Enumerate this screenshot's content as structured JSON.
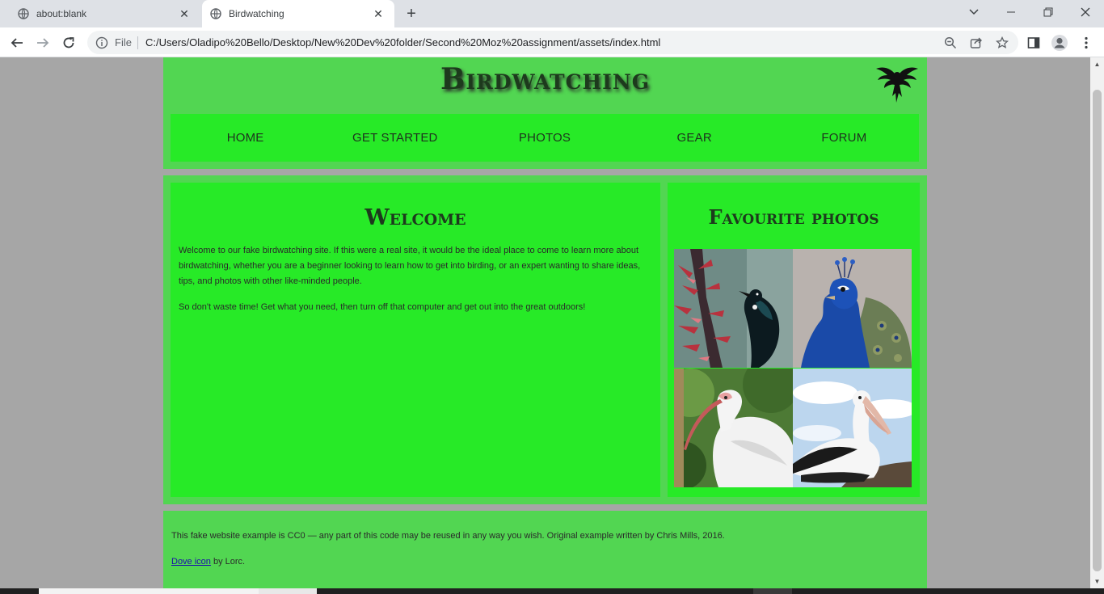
{
  "browser": {
    "tabs": [
      {
        "title": "about:blank",
        "active": false
      },
      {
        "title": "Birdwatching",
        "active": true
      }
    ],
    "new_tab_symbol": "+",
    "close_symbol": "✕",
    "address": {
      "scheme_label": "File",
      "url": "C:/Users/Oladipo%20Bello/Desktop/New%20Dev%20folder/Second%20Moz%20assignment/assets/index.html"
    }
  },
  "site": {
    "title": "Birdwatching",
    "logo_icon": "dove-icon",
    "nav": [
      "HOME",
      "GET STARTED",
      "PHOTOS",
      "GEAR",
      "FORUM"
    ],
    "welcome": {
      "heading": "Welcome",
      "paragraphs": [
        "Welcome to our fake birdwatching site. If this were a real site, it would be the ideal place to come to learn more about birdwatching, whether you are a beginner looking to learn how to get into birding, or an expert wanting to share ideas, tips, and photos with other like-minded people.",
        "So don't waste time! Get what you need, then turn off that computer and get out into the great outdoors!"
      ]
    },
    "favourites": {
      "heading": "Favourite photos",
      "photos": [
        "tui-bird-on-flax-flowers",
        "peacock",
        "white-ibis",
        "pelican"
      ]
    },
    "footer": {
      "license_text": "This fake website example is CC0 — any part of this code may be reused in any way you wish. Original example written by Chris Mills, 2016.",
      "credit_link": "Dove icon",
      "credit_rest": " by Lorc."
    }
  },
  "colors": {
    "page_bg": "#a6a6a6",
    "panel": "#52d652",
    "panel_inner": "#27ea27",
    "heading": "#1d3a1d"
  }
}
